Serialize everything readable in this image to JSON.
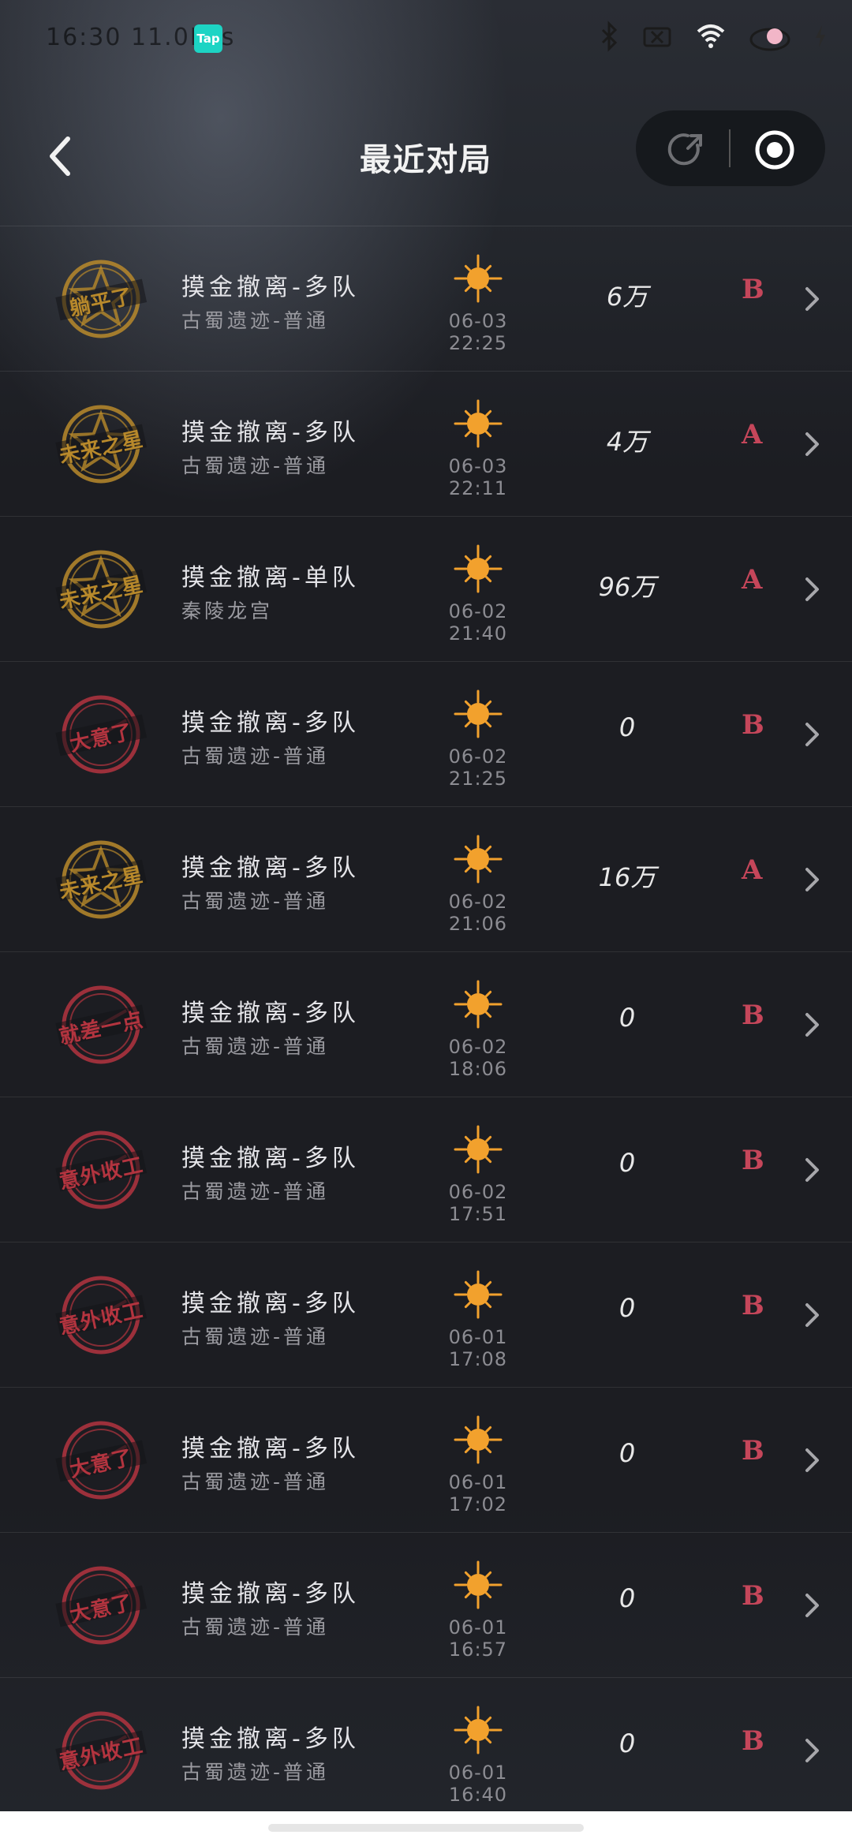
{
  "status_bar": {
    "time": "16:30 11.0M/s",
    "app_badge": "Tap",
    "icons": [
      "bluetooth-icon",
      "battery-saver-icon",
      "wifi-icon",
      "cloud-icon",
      "charging-icon"
    ]
  },
  "header": {
    "title": "最近对局",
    "back_icon": "back-arrow-icon",
    "share_icon": "share-icon",
    "record_icon": "record-icon"
  },
  "colors": {
    "gold_badge": "#b8892b",
    "red_badge": "#b3343f",
    "sun": "#f2a12d",
    "grade": "#c5465a"
  },
  "matches": [
    {
      "badge": "躺平了",
      "badge_color": "gold",
      "mode": "摸金撤离-多队",
      "map": "古蜀遗迹-普通",
      "time": "06-03 22:25",
      "score": "6万",
      "grade": "B"
    },
    {
      "badge": "未来之星",
      "badge_color": "gold",
      "mode": "摸金撤离-多队",
      "map": "古蜀遗迹-普通",
      "time": "06-03 22:11",
      "score": "4万",
      "grade": "A"
    },
    {
      "badge": "未来之星",
      "badge_color": "gold",
      "mode": "摸金撤离-单队",
      "map": "秦陵龙宫",
      "time": "06-02 21:40",
      "score": "96万",
      "grade": "A"
    },
    {
      "badge": "大意了",
      "badge_color": "red",
      "mode": "摸金撤离-多队",
      "map": "古蜀遗迹-普通",
      "time": "06-02 21:25",
      "score": "0",
      "grade": "B"
    },
    {
      "badge": "未来之星",
      "badge_color": "gold",
      "mode": "摸金撤离-多队",
      "map": "古蜀遗迹-普通",
      "time": "06-02 21:06",
      "score": "16万",
      "grade": "A"
    },
    {
      "badge": "就差一点",
      "badge_color": "red",
      "mode": "摸金撤离-多队",
      "map": "古蜀遗迹-普通",
      "time": "06-02 18:06",
      "score": "0",
      "grade": "B"
    },
    {
      "badge": "意外收工",
      "badge_color": "red",
      "mode": "摸金撤离-多队",
      "map": "古蜀遗迹-普通",
      "time": "06-02 17:51",
      "score": "0",
      "grade": "B"
    },
    {
      "badge": "意外收工",
      "badge_color": "red",
      "mode": "摸金撤离-多队",
      "map": "古蜀遗迹-普通",
      "time": "06-01 17:08",
      "score": "0",
      "grade": "B"
    },
    {
      "badge": "大意了",
      "badge_color": "red",
      "mode": "摸金撤离-多队",
      "map": "古蜀遗迹-普通",
      "time": "06-01 17:02",
      "score": "0",
      "grade": "B"
    },
    {
      "badge": "大意了",
      "badge_color": "red",
      "mode": "摸金撤离-多队",
      "map": "古蜀遗迹-普通",
      "time": "06-01 16:57",
      "score": "0",
      "grade": "B"
    },
    {
      "badge": "意外收工",
      "badge_color": "red",
      "mode": "摸金撤离-多队",
      "map": "古蜀遗迹-普通",
      "time": "06-01 16:40",
      "score": "0",
      "grade": "B"
    }
  ]
}
